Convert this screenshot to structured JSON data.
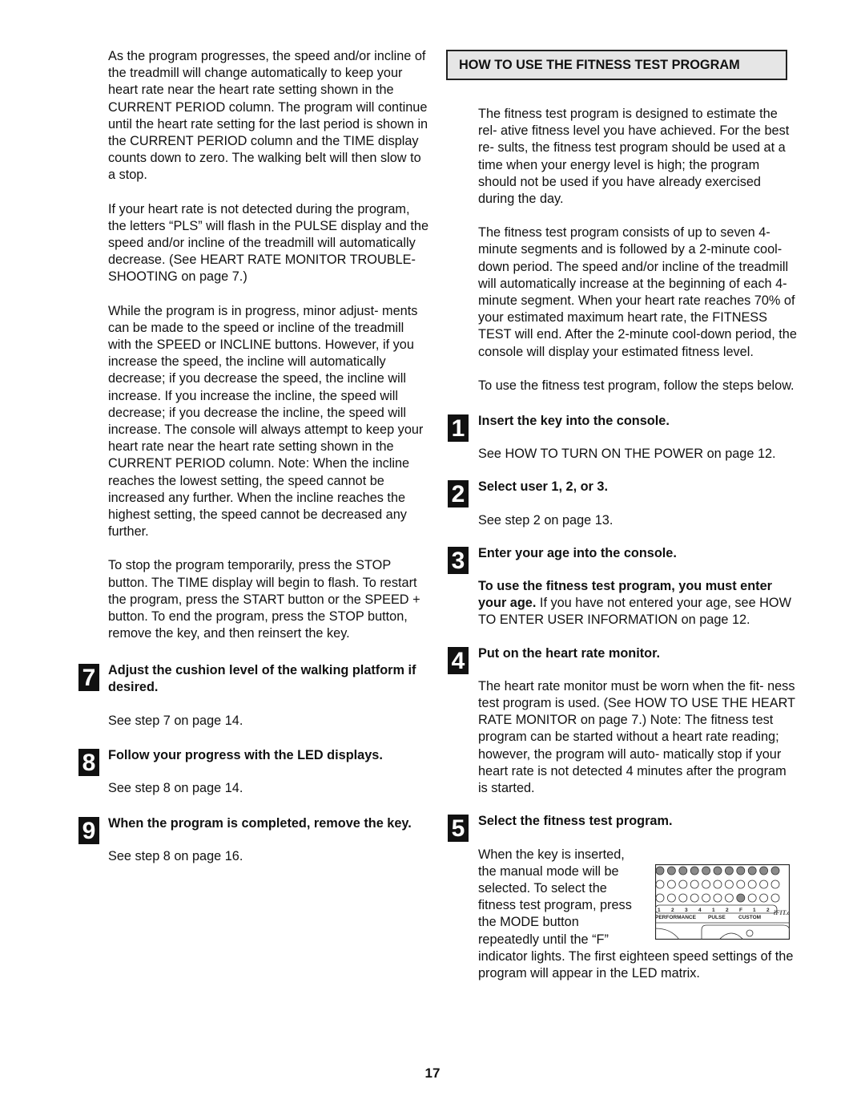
{
  "left_column": {
    "paragraphs": [
      "As the program progresses, the speed and/or incline of the treadmill will change automatically to keep your heart rate near the heart rate setting shown in the CURRENT PERIOD column. The program will continue until the heart rate setting for the last period is shown in the CURRENT PERIOD column and the TIME display counts down to zero. The walking belt will then slow to a stop.",
      "If your heart rate is not detected during the program, the letters “PLS” will flash in the PULSE display and the speed and/or incline of the treadmill will automatically decrease. (See HEART RATE MONITOR TROUBLE-SHOOTING on page 7.)",
      "While the program is in progress, minor adjust- ments can be made to the speed or incline of the treadmill with the SPEED or INCLINE buttons. However, if you increase the speed, the incline will automatically decrease; if you decrease the speed, the incline will increase. If you increase the incline, the speed will decrease; if you decrease the incline, the speed will increase. The console will always attempt to keep your heart rate near the heart rate setting shown in the CURRENT PERIOD column. Note: When the incline reaches the lowest setting, the speed cannot be increased any further. When the incline reaches the highest setting, the speed cannot be decreased any further.",
      "To stop the program temporarily, press the STOP button. The TIME display will begin to flash. To restart the program, press the START button or the SPEED + button. To end the program, press the STOP button, remove the key, and then reinsert the key."
    ],
    "steps": [
      {
        "number": "7",
        "title": "Adjust the cushion level of the walking platform if desired.",
        "body": "See step 7 on page 14."
      },
      {
        "number": "8",
        "title": "Follow your progress with the LED displays.",
        "body": "See step 8 on page 14."
      },
      {
        "number": "9",
        "title": "When the program is completed, remove the key.",
        "body": "See step 8 on page 16."
      }
    ]
  },
  "right_column": {
    "section_header": "HOW TO USE THE FITNESS TEST PROGRAM",
    "paragraphs": [
      "The fitness test program is designed to estimate the rel- ative fitness level you have achieved. For the best re- sults, the fitness test program should be used at a time when your energy level is high; the program should not be used if you have already exercised during the day.",
      "The fitness test program consists of up to seven 4-minute segments and is followed by a 2-minute cool- down period. The speed and/or incline of the treadmill will automatically increase at the beginning of each 4- minute segment. When your heart rate reaches 70% of your estimated maximum heart rate, the FITNESS TEST will end. After the 2-minute cool-down period, the console will display your estimated fitness level.",
      "To use the fitness test program, follow the steps below."
    ],
    "steps": [
      {
        "number": "1",
        "title": "Insert the key into the console.",
        "body": "See HOW TO TURN ON THE POWER on page 12."
      },
      {
        "number": "2",
        "title": "Select user 1, 2, or 3.",
        "body": "See step 2 on page 13."
      },
      {
        "number": "3",
        "title": "Enter your age into the console.",
        "body_bold": "To use the fitness test program, you must enter your age.",
        "body": " If you have not entered your age, see HOW TO ENTER USER INFORMATION on page 12."
      },
      {
        "number": "4",
        "title": "Put on the heart rate monitor.",
        "body": "The heart rate monitor must be worn when the fit- ness test program is used. (See HOW TO USE THE HEART RATE MONITOR on page 7.) Note: The fitness test program can be started without a heart rate reading; however, the program will auto- matically stop if your heart rate is not detected 4 minutes after the program is started."
      },
      {
        "number": "5",
        "title": "Select the fitness test program.",
        "body_wrap": "When the key is inserted, the manual mode will be selected. To select the fitness test program, press the MODE button repeatedly until the “F”",
        "body": "indicator lights. The first eighteen speed settings of the program will appear in the LED matrix."
      }
    ],
    "console_figure": {
      "indicator_labels": [
        "1",
        "2",
        "3",
        "4",
        "1",
        "2",
        "F",
        "1",
        "2"
      ],
      "group_labels": [
        "PERFORMANCE",
        "PULSE",
        "CUSTOM"
      ],
      "brand_mark": "iFIT.com",
      "lit_indicator": "F"
    }
  },
  "page_number": "17"
}
